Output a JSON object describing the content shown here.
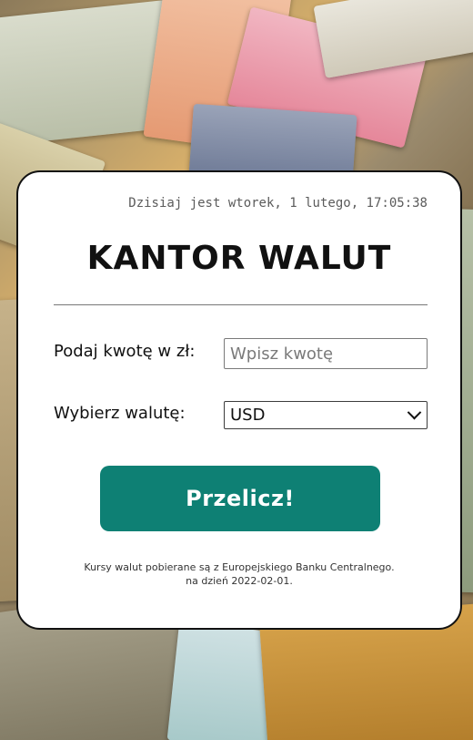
{
  "header": {
    "datetime": "Dzisiaj jest wtorek, 1 lutego, 17:05:38",
    "title": "KANTOR WALUT"
  },
  "form": {
    "amount_label": "Podaj kwotę w zł:",
    "amount_placeholder": "Wpisz kwotę",
    "amount_value": "",
    "currency_label": "Wybierz walutę:",
    "currency_selected": "USD",
    "submit_label": "Przelicz!"
  },
  "footer": {
    "line1": "Kursy walut pobierane są z Europejskiego Banku Centralnego.",
    "line2": "na dzień 2022-02-01."
  },
  "colors": {
    "accent": "#0e8074",
    "card_border": "#111111"
  },
  "icons": {
    "select_arrow": "chevron-down-icon"
  }
}
